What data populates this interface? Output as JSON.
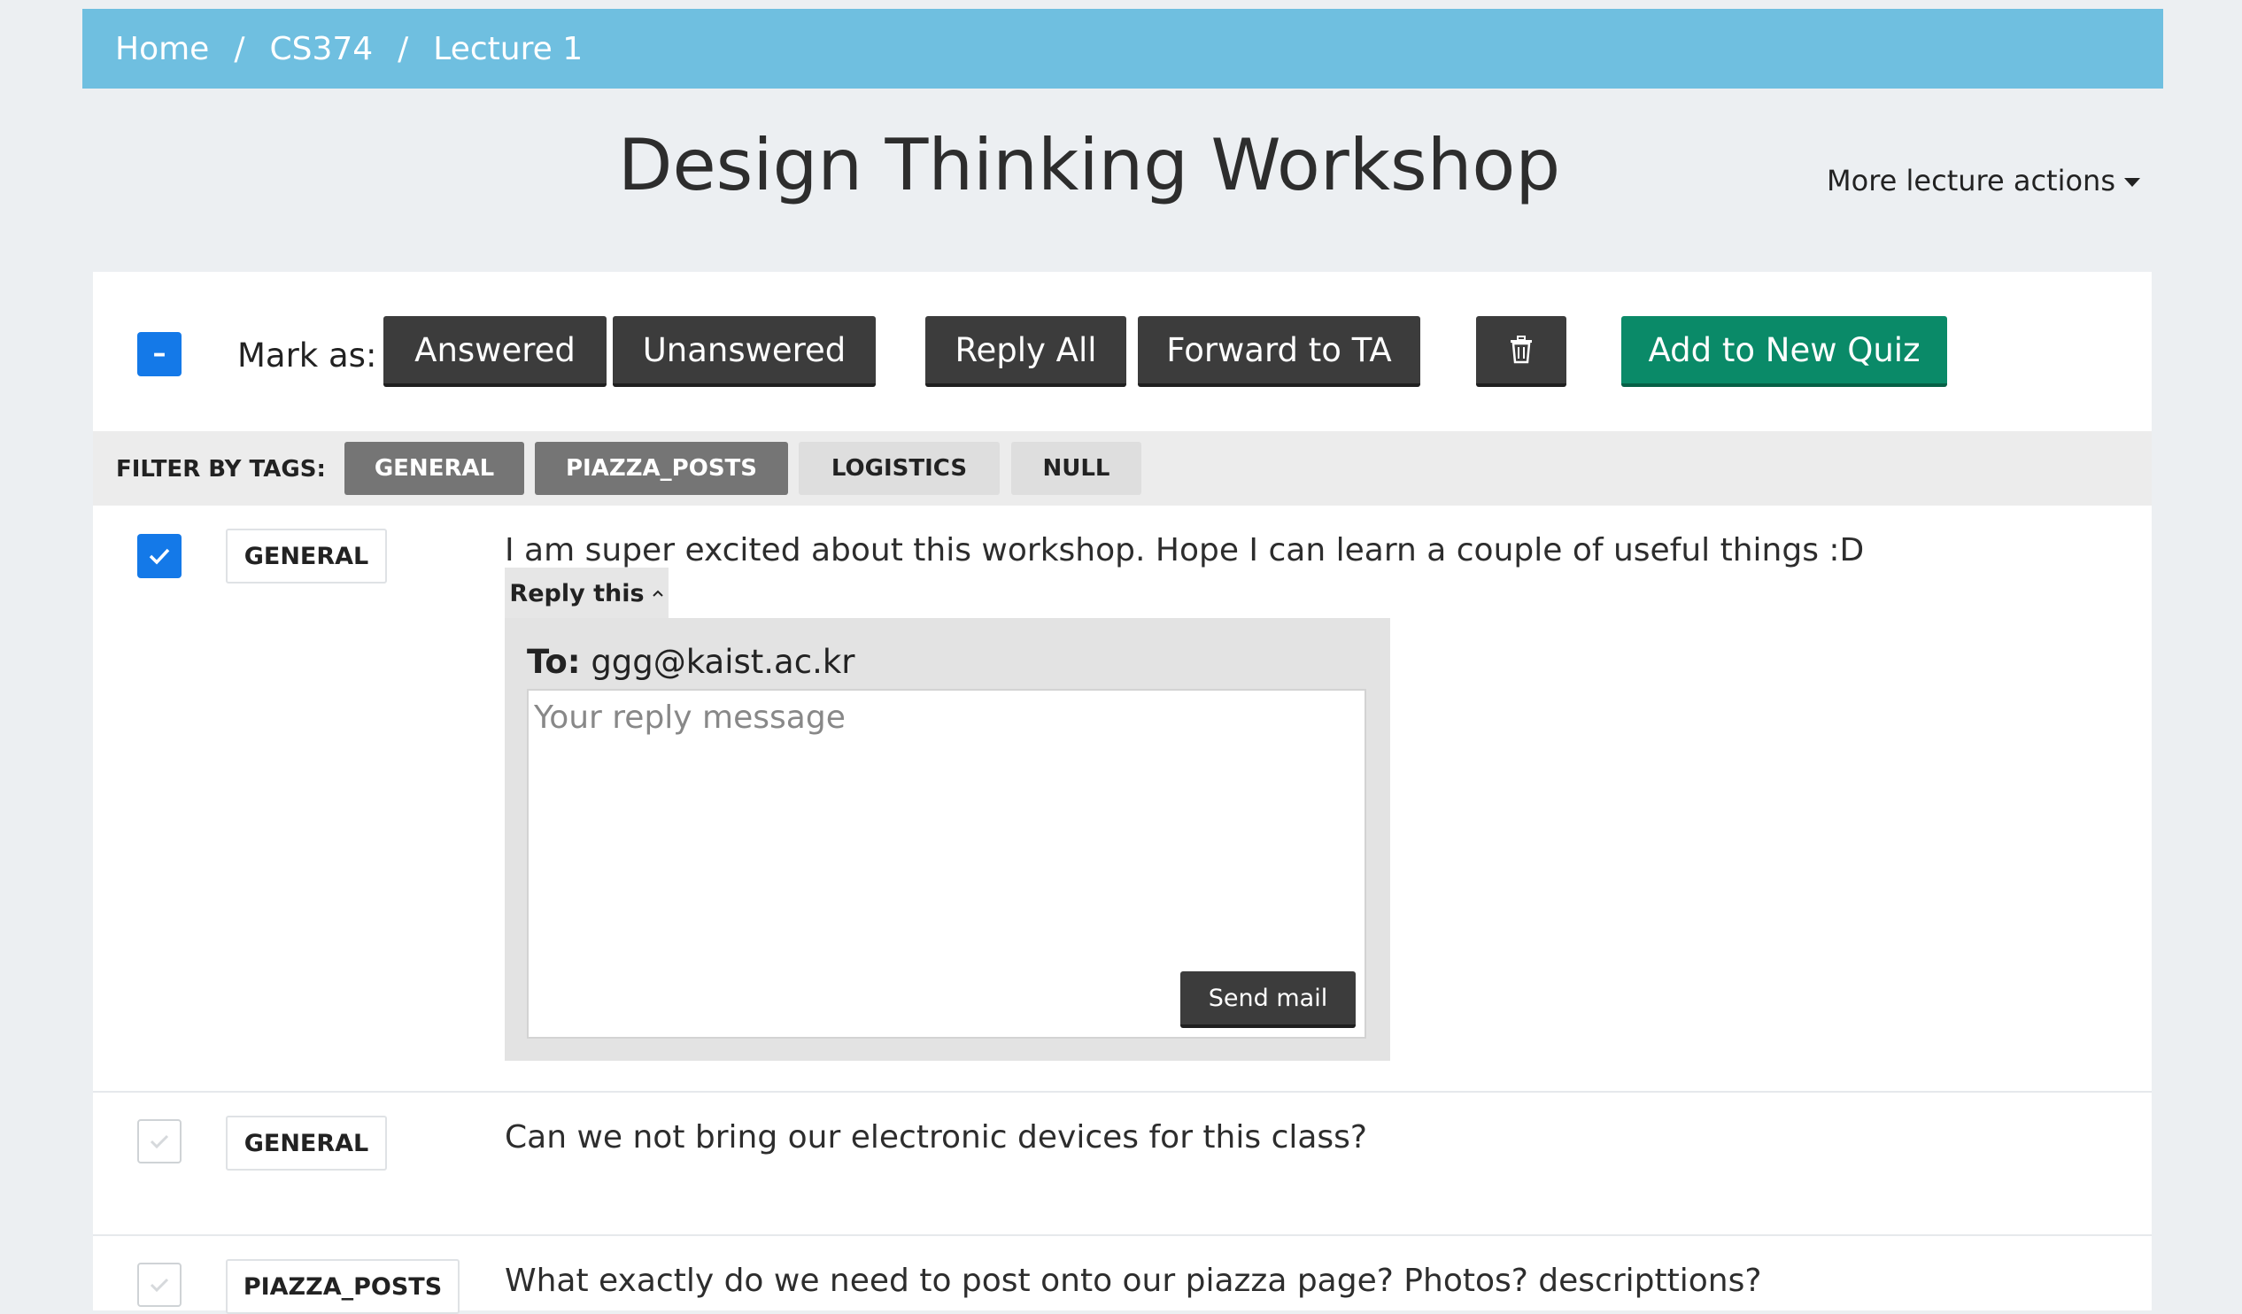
{
  "breadcrumb": {
    "home": "Home",
    "course": "CS374",
    "lecture": "Lecture 1",
    "separator": "/"
  },
  "page_title": "Design Thinking Workshop",
  "more_actions": "More lecture actions",
  "toolbar": {
    "select_all_symbol": "–",
    "mark_as_label": "Mark as:",
    "answered": "Answered",
    "unanswered": "Unanswered",
    "reply_all": "Reply All",
    "forward_to_ta": "Forward to TA",
    "delete_icon": "trash-icon",
    "add_to_quiz": "Add to New Quiz"
  },
  "filter": {
    "label": "FILTER BY TAGS:",
    "tags": [
      {
        "label": "GENERAL",
        "active": true
      },
      {
        "label": "PIAZZA_POSTS",
        "active": true
      },
      {
        "label": "LOGISTICS",
        "active": false
      },
      {
        "label": "NULL",
        "active": false
      }
    ]
  },
  "questions": [
    {
      "checked": true,
      "tag": "GENERAL",
      "text": "I am super excited about this workshop. Hope I can learn a couple of useful things :D",
      "reply": {
        "toggle_label": "Reply this",
        "to_label": "To:",
        "to_address": "ggg@kaist.ac.kr",
        "placeholder": "Your reply message",
        "send_label": "Send mail"
      }
    },
    {
      "checked": false,
      "tag": "GENERAL",
      "text": "Can we not bring our electronic devices for this class?"
    },
    {
      "checked": false,
      "tag": "PIAZZA_POSTS",
      "text": "What exactly do we need to post onto our piazza page? Photos? descripttions?"
    }
  ],
  "colors": {
    "header": "#6fbfe0",
    "accent_blue": "#1479e8",
    "quiz_green": "#0a8a68",
    "button_dark": "#3c3c3c"
  }
}
